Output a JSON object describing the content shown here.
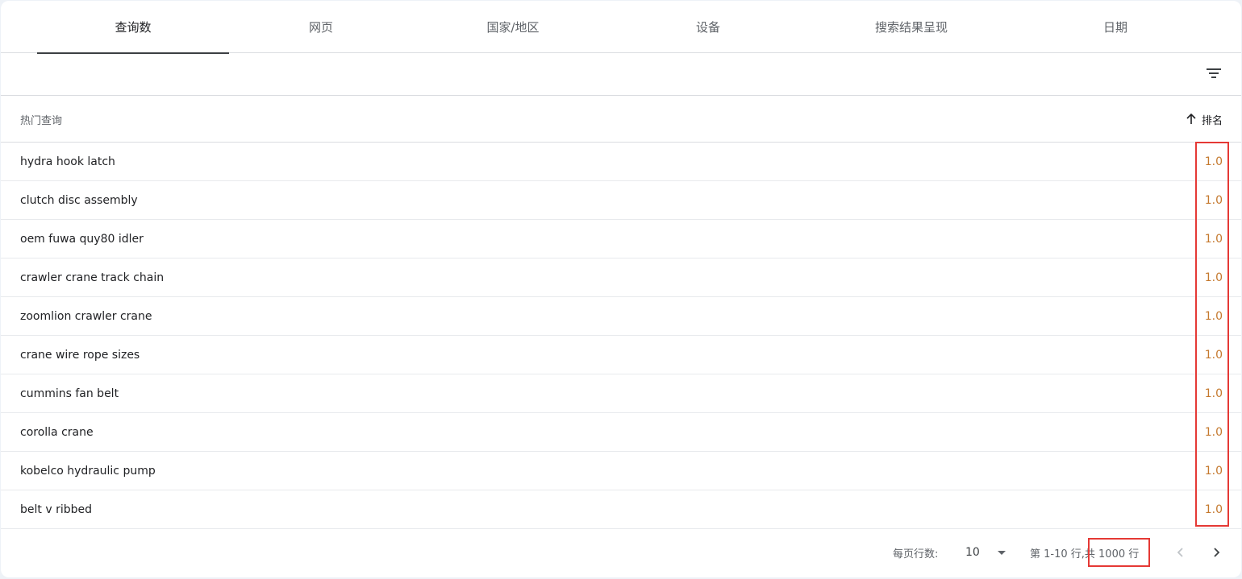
{
  "tabs": [
    {
      "label": "查询数",
      "active": true
    },
    {
      "label": "网页",
      "active": false
    },
    {
      "label": "国家/地区",
      "active": false
    },
    {
      "label": "设备",
      "active": false
    },
    {
      "label": "搜索结果呈现",
      "active": false
    },
    {
      "label": "日期",
      "active": false
    }
  ],
  "filter": {
    "icon": "filter-icon"
  },
  "table": {
    "col_query": "热门查询",
    "col_rank": "排名",
    "sort_icon": "arrow-up-icon",
    "rows": [
      {
        "query": "hydra hook latch",
        "rank": "1.0"
      },
      {
        "query": "clutch disc assembly",
        "rank": "1.0"
      },
      {
        "query": "oem fuwa quy80 idler",
        "rank": "1.0"
      },
      {
        "query": "crawler crane track chain",
        "rank": "1.0"
      },
      {
        "query": "zoomlion crawler crane",
        "rank": "1.0"
      },
      {
        "query": "crane wire rope sizes",
        "rank": "1.0"
      },
      {
        "query": "cummins fan belt",
        "rank": "1.0"
      },
      {
        "query": "corolla crane",
        "rank": "1.0"
      },
      {
        "query": "kobelco hydraulic pump",
        "rank": "1.0"
      },
      {
        "query": "belt v ribbed",
        "rank": "1.0"
      }
    ]
  },
  "pager": {
    "rows_per_page_label": "每页行数:",
    "rows_per_page_value": "10",
    "range_text": "第 1-10 行,",
    "total_text": "共 1000 行",
    "prev_icon": "chevron-left-icon",
    "next_icon": "chevron-right-icon"
  },
  "colors": {
    "rank_value": "#c5792e",
    "highlight": "#e53935",
    "active_tab_underline": "#3c4043"
  }
}
